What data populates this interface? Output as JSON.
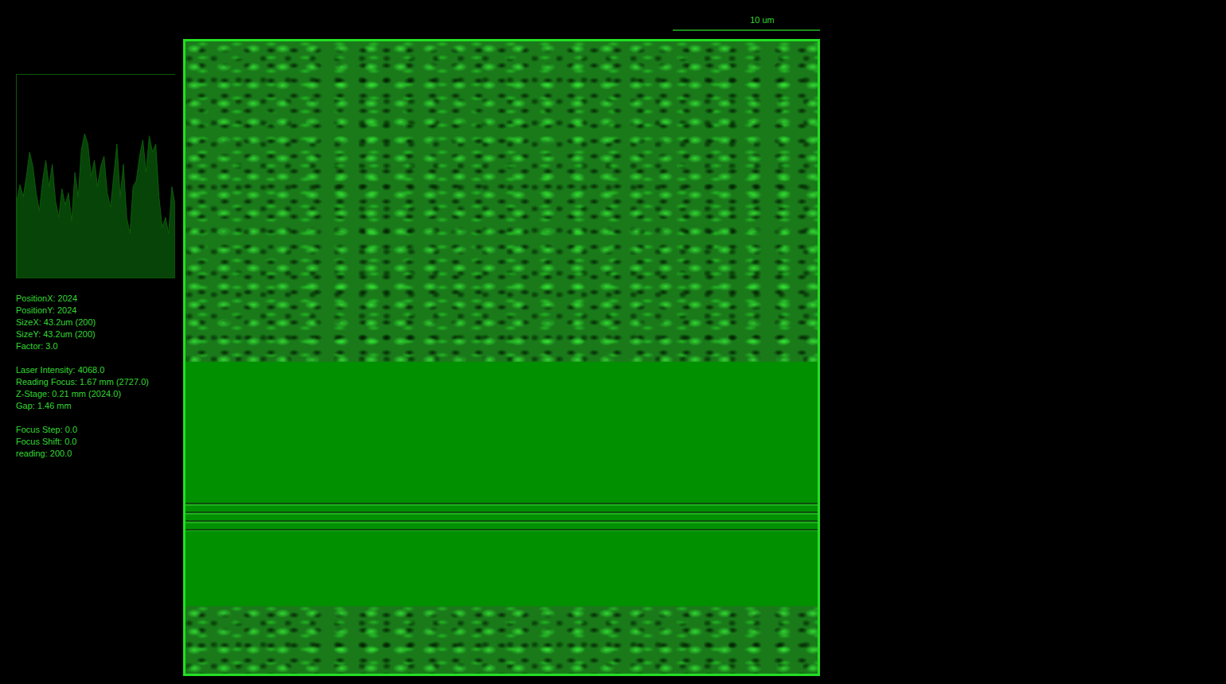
{
  "scale_bar": {
    "label": "10 um"
  },
  "histogram": {
    "values": [
      0.38,
      0.46,
      0.4,
      0.5,
      0.62,
      0.55,
      0.42,
      0.33,
      0.48,
      0.58,
      0.45,
      0.56,
      0.38,
      0.3,
      0.44,
      0.36,
      0.42,
      0.28,
      0.52,
      0.4,
      0.63,
      0.71,
      0.66,
      0.5,
      0.58,
      0.45,
      0.55,
      0.6,
      0.42,
      0.35,
      0.5,
      0.66,
      0.4,
      0.56,
      0.3,
      0.22,
      0.45,
      0.48,
      0.6,
      0.68,
      0.52,
      0.7,
      0.62,
      0.66,
      0.4,
      0.25,
      0.3,
      0.22,
      0.45,
      0.36
    ]
  },
  "info_groups": [
    [
      "PositionX: 2024",
      "PositionY: 2024",
      "SizeX: 43.2um (200)",
      "SizeY: 43.2um (200)",
      "Factor: 3.0"
    ],
    [
      "Laser Intensity: 4068.0",
      "Reading Focus: 1.67 mm (2727.0)",
      "Z-Stage: 0.21 mm (2024.0)",
      "Gap: 1.46 mm"
    ],
    [
      "Focus Step: 0.0",
      "Focus Shift: 0.0",
      "reading: 200.0"
    ]
  ]
}
